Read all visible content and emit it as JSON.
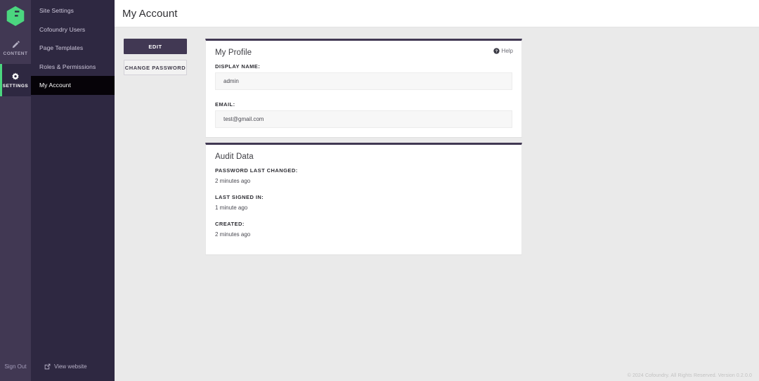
{
  "brand": {
    "logo_icon": "cofoundry-hexagon-logo",
    "accent_green": "#4bd67f",
    "rail_bg": "#413853",
    "menu_bg": "#2e2841",
    "active_menu_bg": "#060308"
  },
  "icon_rail": {
    "items": [
      {
        "label": "Content",
        "icon": "pencil-icon",
        "active": false
      },
      {
        "label": "Settings",
        "icon": "gear-icon",
        "active": true
      }
    ],
    "sign_out_label": "Sign Out"
  },
  "side_menu": {
    "items": [
      {
        "label": "Site Settings",
        "active": false
      },
      {
        "label": "Cofoundry Users",
        "active": false
      },
      {
        "label": "Page Templates",
        "active": false
      },
      {
        "label": "Roles & Permissions",
        "active": false
      },
      {
        "label": "My Account",
        "active": true
      }
    ],
    "view_website_label": "View website",
    "view_website_icon": "external-link-icon"
  },
  "header": {
    "title": "My Account"
  },
  "actions": {
    "edit_label": "Edit",
    "change_password_label": "Change Password"
  },
  "profile_panel": {
    "title": "My Profile",
    "help_label": "Help",
    "help_icon": "question-circle-icon",
    "fields": [
      {
        "label": "Display Name:",
        "value": "admin"
      },
      {
        "label": "Email:",
        "value": "test@gmail.com"
      }
    ]
  },
  "audit_panel": {
    "title": "Audit Data",
    "rows": [
      {
        "label": "Password Last Changed:",
        "value": "2 minutes ago"
      },
      {
        "label": "Last Signed In:",
        "value": "1 minute ago"
      },
      {
        "label": "Created:",
        "value": "2 minutes ago"
      }
    ]
  },
  "footer": {
    "copyright": "© 2024 Cofoundry. All Rights Reserved. Version 0.2.0.0"
  }
}
